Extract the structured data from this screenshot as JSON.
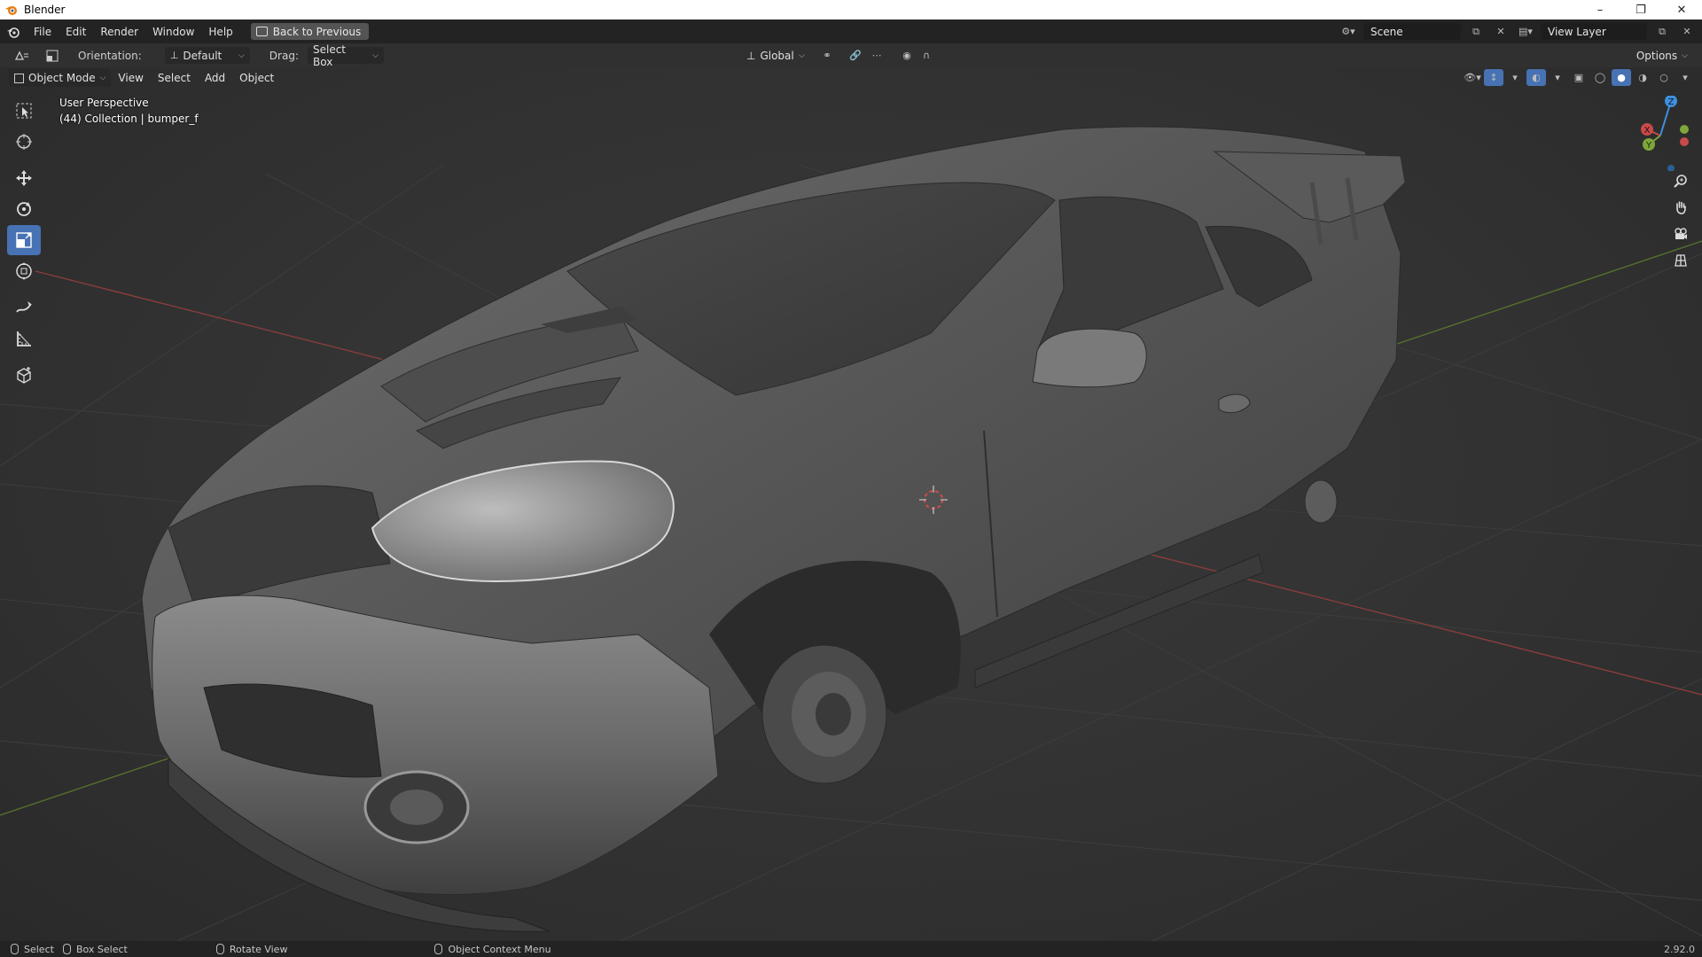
{
  "window": {
    "title": "Blender",
    "controls": [
      "minimize",
      "restore",
      "close"
    ]
  },
  "menubar": {
    "items": [
      "File",
      "Edit",
      "Render",
      "Window",
      "Help"
    ],
    "back_button": "Back to Previous",
    "scene": "Scene",
    "view_layer": "View Layer"
  },
  "toolheader": {
    "orientation_label": "Orientation:",
    "orientation_value": "Default",
    "drag_label": "Drag:",
    "drag_value": "Select Box",
    "transform_orientation": "Global",
    "options": "Options"
  },
  "viewport_header": {
    "mode": "Object Mode",
    "menus": [
      "View",
      "Select",
      "Add",
      "Object"
    ]
  },
  "viewport": {
    "perspective": "User Perspective",
    "active": "(44) Collection | bumper_f"
  },
  "tools": [
    {
      "name": "select-box-icon",
      "active": false
    },
    {
      "name": "cursor-icon",
      "active": false
    },
    {
      "name": "move-icon",
      "active": false
    },
    {
      "name": "rotate-icon",
      "active": false
    },
    {
      "name": "scale-icon",
      "active": true
    },
    {
      "name": "transform-icon",
      "active": false
    },
    {
      "name": "annotate-icon",
      "active": false
    },
    {
      "name": "measure-icon",
      "active": false
    },
    {
      "name": "add-cube-icon",
      "active": false
    }
  ],
  "gizmo": {
    "x": "X",
    "y": "Y",
    "z": "Z"
  },
  "statusbar": {
    "select": "Select",
    "box_select": "Box Select",
    "rotate_view": "Rotate View",
    "context_menu": "Object Context Menu",
    "version": "2.92.0"
  },
  "colors": {
    "accent": "#4772b3",
    "axis_x": "#c84a4a",
    "axis_y": "#7ea63a",
    "axis_z": "#3f8fde"
  }
}
